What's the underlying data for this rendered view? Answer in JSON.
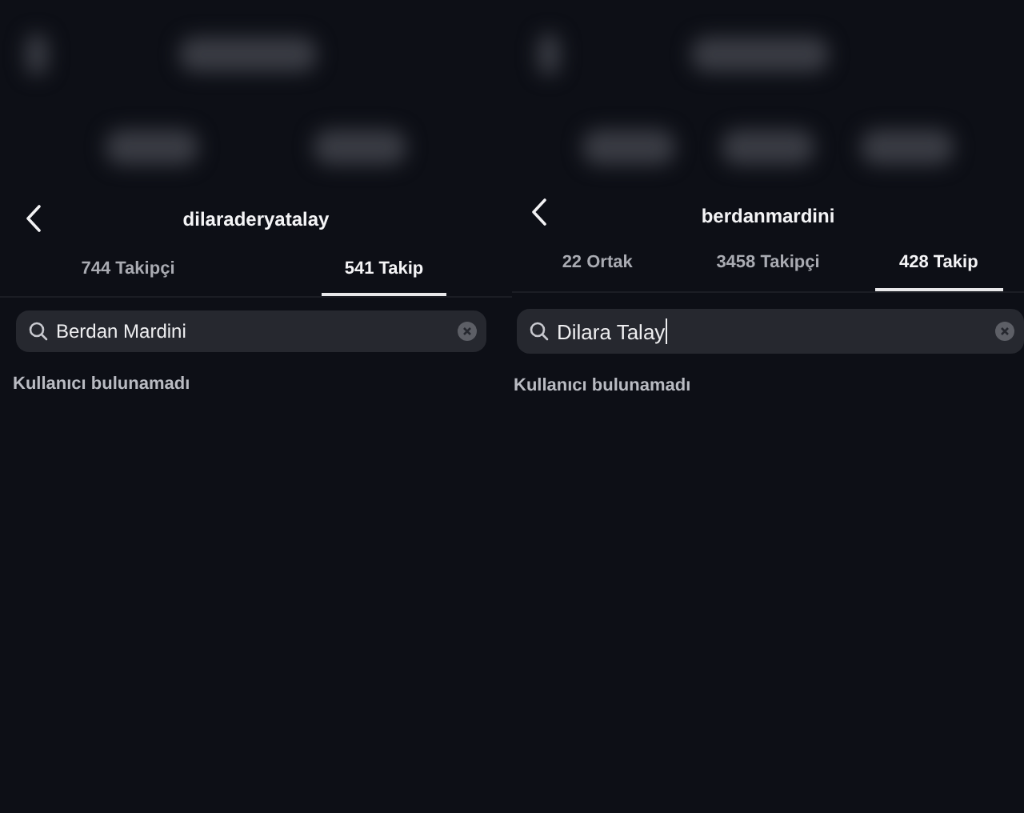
{
  "panels": [
    {
      "username": "dilaraderyatalay",
      "tabs": [
        {
          "label": "744 Takipçi",
          "selected": false
        },
        {
          "label": "541 Takip",
          "selected": true
        }
      ],
      "search": {
        "value": "Berdan Mardini",
        "cursor": false
      },
      "message": "Kullanıcı bulunamadı"
    },
    {
      "username": "berdanmardini",
      "tabs": [
        {
          "label": "22 Ortak",
          "selected": false
        },
        {
          "label": "3458 Takipçi",
          "selected": false
        },
        {
          "label": "428 Takip",
          "selected": true
        }
      ],
      "search": {
        "value": "Dilara Talay",
        "cursor": true
      },
      "message": "Kullanıcı bulunamadı"
    }
  ]
}
